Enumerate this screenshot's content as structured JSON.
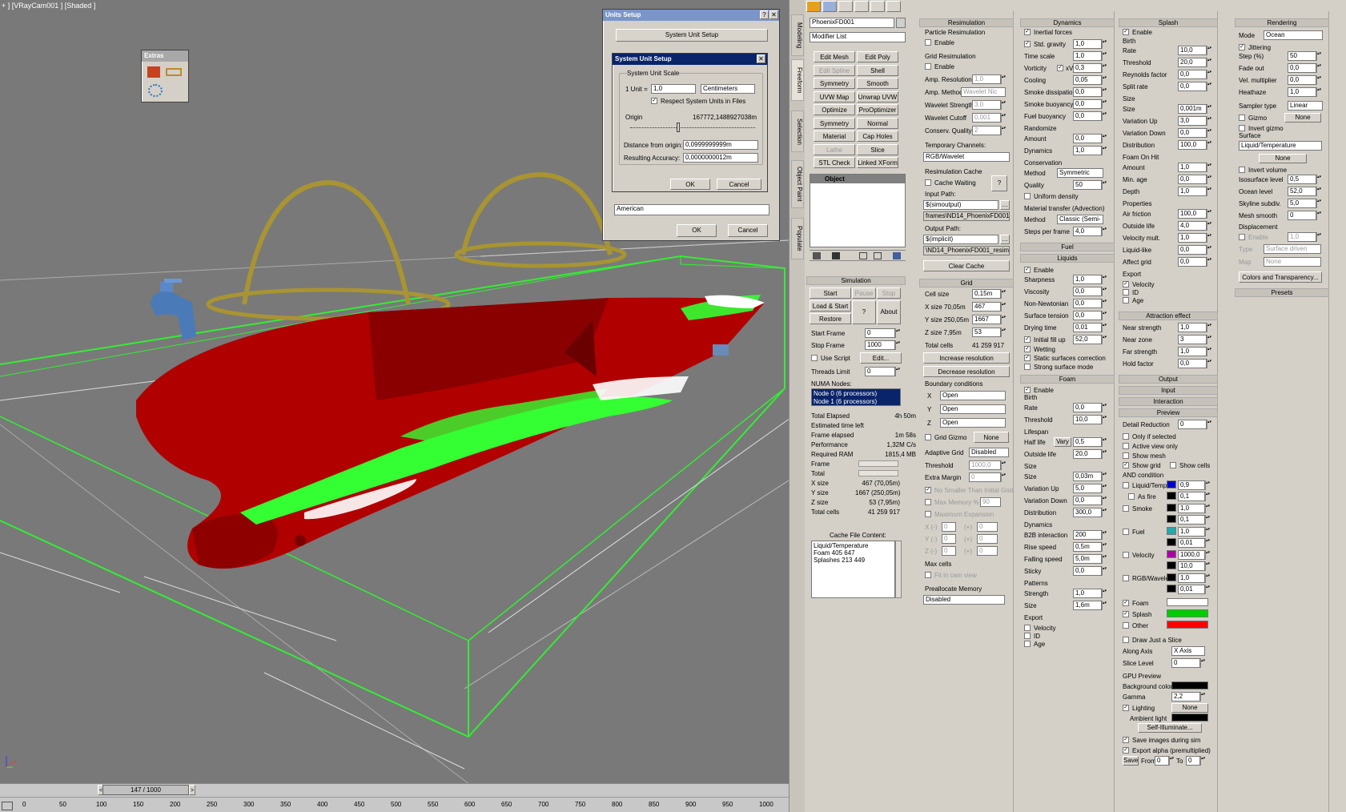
{
  "viewport": {
    "label": "+ ] [VRayCam001 ] [Shaded ]"
  },
  "timeline": {
    "slider": "147 / 1000",
    "ticks": [
      "0",
      "50",
      "100",
      "150",
      "200",
      "250",
      "300",
      "350",
      "400",
      "450",
      "500",
      "550",
      "600",
      "650",
      "700",
      "750",
      "800",
      "850",
      "900",
      "950",
      "1000"
    ]
  },
  "extras": {
    "title": "Extras"
  },
  "units": {
    "title": "Units Setup",
    "system_btn": "System Unit Setup",
    "ok": "OK",
    "cancel": "Cancel",
    "lighting": "American",
    "sys": {
      "title": "System Unit Setup",
      "scale_group": "System Unit Scale",
      "unit_label": "1 Unit =",
      "unit_value": "1,0",
      "unit_type": "Centimeters",
      "respect": "Respect System Units in Files",
      "origin_label": "Origin",
      "origin_value": "167772,1488927038m",
      "dist_label": "Distance from origin:",
      "dist_value": "0,0999999999m",
      "acc_label": "Resulting Accuracy:",
      "acc_value": "0,0000000012m",
      "ok": "OK",
      "cancel": "Cancel"
    }
  },
  "side_tabs": [
    "Modeling",
    "Freeform",
    "Selection",
    "Object Paint",
    "Populate"
  ],
  "modpanel": {
    "name": "PhoenixFD001",
    "modlist": "Modifier List",
    "buttons": [
      "Edit Mesh",
      "Edit Poly",
      "Edit Spline",
      "Shell",
      "Symmetry",
      "Smooth",
      "UVW Map",
      "Unwrap UVW",
      "Optimize",
      "ProOptimizer",
      "Symmetry",
      "Normal",
      "Material",
      "Cap Holes",
      "Lathe",
      "Slice",
      "STL Check",
      "Linked XForm"
    ],
    "stack_item": "Object"
  },
  "sim": {
    "title": "Simulation",
    "start": "Start",
    "pause": "Pause",
    "stop": "Stop",
    "load": "Load & Start",
    "q": "?",
    "about": "About",
    "restore": "Restore",
    "start_frame_l": "Start Frame",
    "start_frame": "0",
    "stop_frame_l": "Stop Frame",
    "stop_frame": "1000",
    "use_script": "Use Script",
    "edit": "Edit...",
    "threads_l": "Threads Limit",
    "threads": "0",
    "numa": "NUMA Nodes:",
    "node0": "Node 0 (6 processors)",
    "node1": "Node 1 (6 processors)",
    "stats": [
      [
        "Total Elapsed",
        "4h 50m"
      ],
      [
        "Estimated time left",
        ""
      ],
      [
        "Frame elapsed",
        "1m 58s"
      ],
      [
        "Performance",
        "1,32M C/s"
      ],
      [
        "Required RAM",
        "1815,4 MB"
      ],
      [
        "Frame",
        ""
      ],
      [
        "Total",
        ""
      ],
      [
        "X size",
        "467 (70,05m)"
      ],
      [
        "Y size",
        "1667 (250,05m)"
      ],
      [
        "Z size",
        "53 (7,95m)"
      ],
      [
        "Total cells",
        "41 259 917"
      ]
    ],
    "cache_content": "Cache File Content:",
    "cache_lines": [
      "Liquid/Temperature",
      "Foam  405 647",
      "Splashes  213 449"
    ]
  },
  "resim": {
    "title": "Resimulation",
    "particle": "Particle Resimulation",
    "enable1": "Enable",
    "grid": "Grid Resimulation",
    "enable2": "Enable",
    "amp_res": "Amp. Resolution",
    "amp_res_v": "1,0",
    "amp_method": "Amp. Method",
    "amp_method_v": "Wavelet Nic",
    "wl_strength": "Wavelet Strength",
    "wl_strength_v": "3,0",
    "wl_cutoff": "Wavelet Cutoff",
    "wl_cutoff_v": "0,001",
    "conserv": "Conserv. Quality",
    "conserv_v": "2",
    "temp_ch": "Temporary Channels:",
    "temp_ch_v": "RGB/Wavelet",
    "cache": "Resimulation Cache",
    "cache_wait": "Cache Waiting",
    "q": "?",
    "input": "Input Path:",
    "input_v": "$(simoutput)",
    "input_v2": "frames\\ND14_PhoenixFD001",
    "output": "Output Path:",
    "output_v": "$(implicit)",
    "output_v2": "\\ND14_PhoenixFD001_resim",
    "clear": "Clear Cache"
  },
  "grid": {
    "title": "Grid",
    "cell": "Cell size",
    "cell_v": "0,15m",
    "xs": "X size 70,05m",
    "xs_v": "467",
    "ys": "Y size 250,05m",
    "ys_v": "1667",
    "zs": "Z size 7,95m",
    "zs_v": "53",
    "total": "Total cells",
    "total_v": "41 259 917",
    "inc": "Increase resolution",
    "dec": "Decrease resolution",
    "bc": "Boundary conditions",
    "x": "X",
    "xv": "Open",
    "y": "Y",
    "yv": "Open",
    "z": "Z",
    "zv": "Open",
    "gizmo": "Grid Gizmo",
    "none": "None",
    "adaptive": "Adaptive Grid",
    "adaptive_v": "Disabled",
    "threshold": "Threshold",
    "threshold_v": "1000,0",
    "margin": "Extra Margin",
    "margin_v": "0",
    "no_smaller": "No Smaller Than Initial Grid",
    "max_mem": "Max Memory %",
    "max_mem_v": "90",
    "max_exp": "Maximum Expansion",
    "xm": "X (-)",
    "xp": "(+)",
    "ym": "Y (-)",
    "zm": "Z (-)",
    "zero": "0",
    "max_cells": "Max cells",
    "fit": "Fit in cam view",
    "prealloc": "Preallocate Memory",
    "prealloc_v": "Disabled"
  },
  "dyn": {
    "title": "Dynamics",
    "inertial": "Inertial forces",
    "gravity": "Std. gravity",
    "gravity_v": "1,0",
    "timescale": "Time scale",
    "timescale_v": "1,0",
    "vorticity": "Vorticity",
    "xv": "xV",
    "vort_v": "0,3",
    "cooling": "Cooling",
    "cooling_v": "0,05",
    "smoke_diss": "Smoke dissipation",
    "smoke_diss_v": "0,0",
    "smoke_buoy": "Smoke buoyancy",
    "smoke_buoy_v": "0,0",
    "fuel_buoy": "Fuel buoyancy",
    "fuel_buoy_v": "0,0",
    "randomize": "Randomize",
    "amount": "Amount",
    "amount_v": "0,0",
    "dynamics": "Dynamics",
    "dynamics_v": "1,0",
    "conservation": "Conservation",
    "method": "Method",
    "method_v": "Symmetric",
    "quality": "Quality",
    "quality_v": "50",
    "uniform": "Uniform density",
    "mat_transfer": "Material transfer (Advection)",
    "method2": "Method",
    "method2_v": "Classic (Semi-",
    "steps": "Steps per frame",
    "steps_v": "4,0",
    "fuel": "Fuel",
    "liquids": "Liquids",
    "l_enable": "Enable",
    "sharp": "Sharpness",
    "sharp_v": "1,0",
    "visc": "Viscosity",
    "visc_v": "0,0",
    "nonnewt": "Non-Newtonian",
    "nonnewt_v": "0,0",
    "surf": "Surface tension",
    "surf_v": "0,0",
    "drying": "Drying time",
    "drying_v": "0,01",
    "initfill": "Initial fill up",
    "initfill_v": "52,0",
    "wetting": "Wetting",
    "static": "Static surfaces correction",
    "strong": "Strong surface mode",
    "foam": "Foam",
    "f_enable": "Enable",
    "birth": "Birth",
    "rate": "Rate",
    "rate_v": "0,0",
    "thr": "Threshold",
    "thr_v": "10,0",
    "lifespan": "Lifespan",
    "halflife": "Half life",
    "vary": "Vary",
    "halflife_v": "0,5",
    "outside": "Outside life",
    "outside_v": "20,0",
    "size": "Size",
    "size_l": "Size",
    "size_v": "0,03m",
    "varup": "Variation Up",
    "varup_v": "5,0",
    "vardown": "Variation Down",
    "vardown_v": "0,0",
    "distr": "Distribution",
    "distr_v": "300,0",
    "dyn2": "Dynamics",
    "b2b": "B2B interaction",
    "b2b_v": "200",
    "rise": "Rise speed",
    "rise_v": "0,5m",
    "fall": "Falling speed",
    "fall_v": "5,0m",
    "sticky": "Sticky",
    "sticky_v": "0,0",
    "patterns": "Patterns",
    "strength": "Strength",
    "strength_v": "1,0",
    "psize": "Size",
    "psize_v": "1,6m",
    "export": "Export",
    "velocity": "Velocity",
    "id": "ID",
    "age": "Age"
  },
  "splash": {
    "title": "Splash",
    "enable": "Enable",
    "birth": "Birth",
    "rate": "Rate",
    "rate_v": "10,0",
    "thr": "Threshold",
    "thr_v": "20,0",
    "reynolds": "Reynolds factor",
    "reynolds_v": "0,0",
    "split": "Split rate",
    "split_v": "0,0",
    "size": "Size",
    "size_l": "Size",
    "size_v": "0,001m",
    "varup": "Variation Up",
    "varup_v": "3,0",
    "vardown": "Variation Down",
    "vardown_v": "0,0",
    "distr": "Distribution",
    "distr_v": "100,0",
    "foamhit": "Foam On Hit",
    "amount": "Amount",
    "amount_v": "1,0",
    "minage": "Min. age",
    "minage_v": "0,0",
    "depth": "Depth",
    "depth_v": "1,0",
    "props": "Properties",
    "air": "Air friction",
    "air_v": "100,0",
    "outside": "Outside life",
    "outside_v": "4,0",
    "velmult": "Velocity mult.",
    "velmult_v": "1,0",
    "liqlike": "Liquid-like",
    "liqlike_v": "0,0",
    "affect": "Affect grid",
    "affect_v": "0,0",
    "export": "Export",
    "velocity": "Velocity",
    "id": "ID",
    "age": "Age",
    "attraction": "Attraction effect",
    "near": "Near strength",
    "near_v": "1,0",
    "nearzone": "Near zone",
    "nearzone_v": "3",
    "far": "Far strength",
    "far_v": "1,0",
    "hold": "Hold factor",
    "hold_v": "0,0",
    "output": "Output",
    "input": "Input",
    "interaction": "Interaction",
    "preview": "Preview",
    "detail": "Detail Reduction",
    "detail_v": "0",
    "only_sel": "Only if selected",
    "active": "Active view only",
    "showmesh": "Show mesh",
    "showgrid": "Show grid",
    "showcells": "Show cells",
    "andcond": "AND condition",
    "liqtemp": "Liquid/Temp.",
    "liqtemp_v": "0,9",
    "asfire": "As fire",
    "asfire_v": "0,1",
    "smoke": "Smoke",
    "smoke_v": "1,0",
    "smoke_v2": "0,1",
    "fuel": "Fuel",
    "fuel_v": "1,0",
    "fuel_v2": "0,01",
    "vel": "Velocity",
    "vel_v": "1000,0",
    "vel_v2": "10,0",
    "rgbw": "RGB/Wavelet",
    "rgbw_v": "1,0",
    "rgbw_v2": "0,01",
    "foam": "Foam",
    "splash2": "Splash",
    "other": "Other",
    "drawslice": "Draw Just a Slice",
    "along": "Along Axis",
    "along_v": "X Axis",
    "slicelvl": "Slice Level",
    "slicelvl_v": "0",
    "gpu": "GPU Preview",
    "bg": "Background color",
    "gamma": "Gamma",
    "gamma_v": "2,2",
    "lighting": "Lighting",
    "none": "None",
    "ambient": "Ambient light",
    "selfillum": "Self-Illuminate...",
    "saveimg": "Save images during sim",
    "exportalpha": "Export alpha (premultiplied)",
    "save": "Save",
    "from": "From",
    "from_v": "0",
    "to": "To",
    "to_v": "0"
  },
  "render": {
    "title": "Rendering",
    "mode": "Mode",
    "mode_v": "Ocean",
    "jitter": "Jittering",
    "step": "Step (%)",
    "step_v": "50",
    "fade": "Fade out",
    "fade_v": "0,0",
    "velmult": "Vel. multiplier",
    "velmult_v": "0,0",
    "heathaze": "Heathaze",
    "heathaze_v": "1,0",
    "sampler": "Sampler type",
    "sampler_v": "Linear",
    "gizmo": "Gizmo",
    "none": "None",
    "invgizmo": "Invert gizmo",
    "surface": "Surface",
    "surface_v": "Liquid/Temperature",
    "none2": "None",
    "invvol": "Invert volume",
    "iso": "Isosurface level",
    "iso_v": "0,5",
    "ocean": "Ocean level",
    "ocean_v": "52,0",
    "skyline": "Skyline subdiv.",
    "skyline_v": "5,0",
    "meshsmooth": "Mesh smooth",
    "meshsmooth_v": "0",
    "displace": "Displacement",
    "d_enable": "Enable",
    "d_enable_v": "1,0",
    "type": "Type",
    "type_v": "Surface driven",
    "map": "Map",
    "map_v": "None",
    "colors": "Colors and Transparency...",
    "presets": "Presets"
  },
  "colors": {
    "accent": "#0a246a",
    "hull": "#b00000",
    "foam_green": "#33ff33",
    "liq_swatch": "#0000cc",
    "smoke_swatch": "#000000",
    "fuel_swatch": "#22aaaa",
    "vel_swatch": "#aa00aa",
    "foam_sw": "#ffffff",
    "splash_sw": "#00cc00",
    "other_sw": "#ff0000"
  }
}
